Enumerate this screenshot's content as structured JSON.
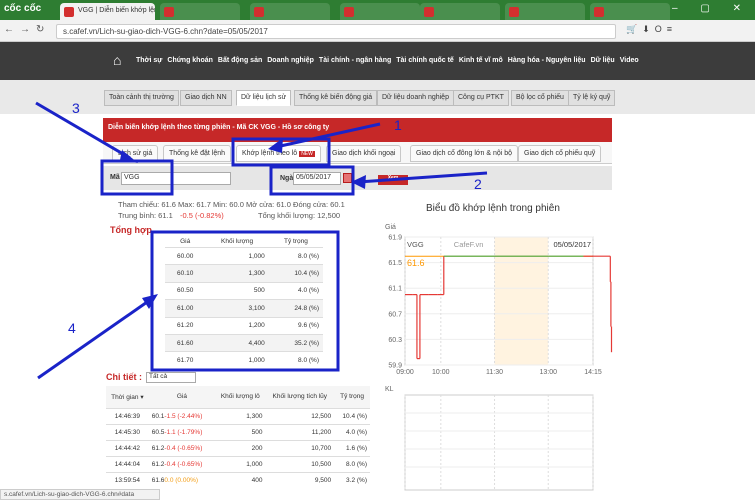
{
  "browser": {
    "logo": "cốc cốc",
    "tabs": [
      {
        "label": "VGG | Diễn biến khớp lệnh",
        "active": true
      },
      {
        "label": "",
        "active": false
      },
      {
        "label": "",
        "active": false
      },
      {
        "label": "",
        "active": false
      },
      {
        "label": "",
        "active": false
      },
      {
        "label": "",
        "active": false
      },
      {
        "label": "",
        "active": false
      }
    ],
    "url": "s.cafef.vn/Lich-su-giao-dich-VGG-6.chn?date=05/05/2017",
    "status_url": "s.cafef.vn/Lich-su-giao-dich-VGG-6.chn#data"
  },
  "site_nav": {
    "items": [
      "Thời sự",
      "Chứng khoán",
      "Bất động sản",
      "Doanh nghiệp",
      "Tài chính - ngân hàng",
      "Tài chính quốc tế",
      "Kinh tế vĩ mô",
      "Hàng hóa - Nguyên liệu",
      "Dữ liệu",
      "Video"
    ]
  },
  "section_tabs": [
    {
      "label": "Toàn cảnh thị trường",
      "active": false
    },
    {
      "label": "Giao dịch NN",
      "active": false
    },
    {
      "label": "Dữ liệu lịch sử",
      "active": true
    },
    {
      "label": "Thống kê biến động giá",
      "active": false
    },
    {
      "label": "Dữ liệu doanh nghiệp",
      "active": false
    },
    {
      "label": "Công cụ PTKT",
      "active": false
    },
    {
      "label": "Bộ lọc cổ phiếu",
      "active": false
    },
    {
      "label": "Tỷ lệ ký quỹ",
      "active": false
    }
  ],
  "header": {
    "title": "Diễn biến khớp lệnh theo từng phiên - Mã CK VGG - Hồ sơ công ty"
  },
  "sub_tabs": [
    {
      "label": "Lịch sử giá",
      "active": false
    },
    {
      "label": "Thống kê đặt lệnh",
      "active": false
    },
    {
      "label": "Khớp lệnh theo lô",
      "active": true,
      "badge": "NEW"
    },
    {
      "label": "Giao dịch khối ngoại",
      "active": false
    },
    {
      "label": "Giao dịch cổ đông lớn & nội bộ",
      "active": false
    },
    {
      "label": "Giao dịch cổ phiếu quỹ",
      "active": false
    }
  ],
  "filter": {
    "ma_label": "Mã",
    "ma_value": "VGG",
    "ngay_label": "Ngày",
    "ngay_value": "05/05/2017",
    "xem_label": "Xem"
  },
  "stats": {
    "line1": "Tham chiếu: 61.6   Max: 61.7   Min: 60.0   Mở cửa: 61.0   Đóng cửa: 60.1",
    "tb_label": "Trung bình: 61.1",
    "tb_change": "-0.5 (-0.82%)",
    "tongkl": "Tổng khối lượng: 12,500"
  },
  "summary": {
    "title": "Tổng hợp",
    "headers": [
      "Giá",
      "Khối lượng",
      "Tỷ trọng"
    ],
    "rows": [
      [
        "60.00",
        "1,000",
        "8.0 (%)"
      ],
      [
        "60.10",
        "1,300",
        "10.4 (%)"
      ],
      [
        "60.50",
        "500",
        "4.0 (%)"
      ],
      [
        "61.00",
        "3,100",
        "24.8 (%)"
      ],
      [
        "61.20",
        "1,200",
        "9.6 (%)"
      ],
      [
        "61.60",
        "4,400",
        "35.2 (%)"
      ],
      [
        "61.70",
        "1,000",
        "8.0 (%)"
      ]
    ]
  },
  "detail": {
    "title": "Chi tiết :",
    "filter_value": "Tất cả",
    "headers": [
      "Thời gian ▾",
      "Giá",
      "Khối lượng lô",
      "Khối lượng tích lũy",
      "Tỷ trọng"
    ],
    "rows": [
      {
        "time": "14:46:39",
        "price": "60.1",
        "change": "-1.5 (-2.44%)",
        "vol": "1,300",
        "cum": "12,500",
        "pct": "10.4 (%)"
      },
      {
        "time": "14:45:30",
        "price": "60.5",
        "change": "-1.1 (-1.79%)",
        "vol": "500",
        "cum": "11,200",
        "pct": "4.0 (%)"
      },
      {
        "time": "14:44:42",
        "price": "61.2",
        "change": "-0.4 (-0.65%)",
        "vol": "200",
        "cum": "10,700",
        "pct": "1.6 (%)"
      },
      {
        "time": "14:44:04",
        "price": "61.2",
        "change": "-0.4 (-0.65%)",
        "vol": "1,000",
        "cum": "10,500",
        "pct": "8.0 (%)"
      },
      {
        "time": "13:59:54",
        "price": "61.6",
        "change": "0.0 (0.00%)",
        "vol": "400",
        "cum": "9,500",
        "pct": "3.2 (%)"
      }
    ]
  },
  "chart_data": {
    "type": "line",
    "title": "Biểu đồ khớp lệnh trong phiên",
    "ylabel": "Giá",
    "ylabel2": "KL",
    "series_label": "VGG",
    "watermark": "CafeF.vn",
    "date": "05/05/2017",
    "reference_label": "61.6",
    "reference_value": 61.6,
    "ylim": [
      59.9,
      61.9
    ],
    "yticks": [
      "61.9",
      "61.5",
      "61.1",
      "60.7",
      "60.3",
      "59.9"
    ],
    "xticks": [
      "09:00",
      "10:00",
      "11:30",
      "13:00",
      "14:15"
    ],
    "x": [
      "09:00",
      "09:12",
      "09:15",
      "09:20",
      "09:25",
      "09:40",
      "09:55",
      "10:05",
      "11:30",
      "13:00",
      "13:59",
      "14:44",
      "14:45",
      "14:46"
    ],
    "values": [
      61.0,
      61.0,
      61.0,
      60.0,
      61.0,
      61.0,
      61.0,
      61.6,
      61.6,
      61.6,
      61.6,
      61.2,
      60.5,
      60.1
    ],
    "colors": {
      "up": "#4caf50",
      "down": "#e53935",
      "reference": "#ff9800"
    }
  },
  "annotations": {
    "labels": [
      "1",
      "2",
      "3",
      "4"
    ]
  }
}
